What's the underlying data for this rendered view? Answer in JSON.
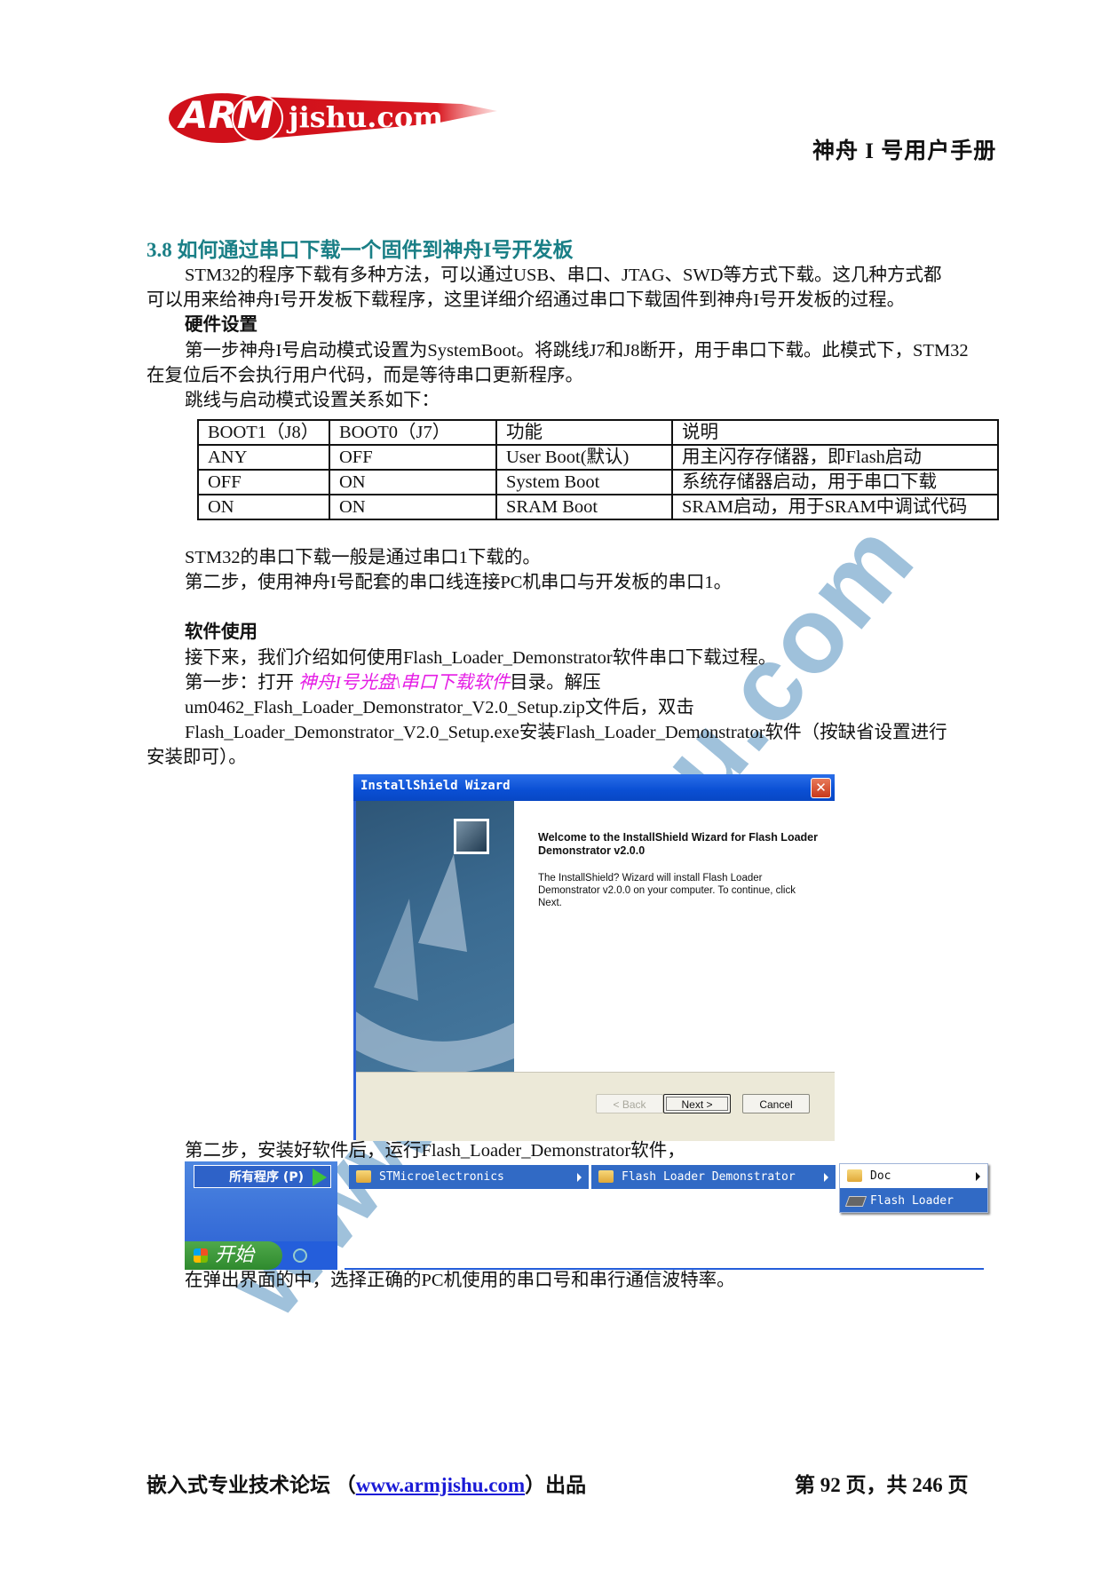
{
  "header": {
    "logo_text_arm": "ARM",
    "logo_text_site": "jishu.com",
    "doc_title": "神舟 I 号用户手册"
  },
  "section": {
    "title": "3.8 如何通过串口下载一个固件到神舟I号开发板",
    "intro_line1": "STM32的程序下载有多种方法，可以通过USB、串口、JTAG、SWD等方式下载。这几种方式都",
    "intro_line2": "可以用来给神舟I号开发板下载程序，这里详细介绍通过串口下载固件到神舟I号开发板的过程。",
    "hw_heading": "硬件设置",
    "hw_step1_line1": "第一步神舟I号启动模式设置为SystemBoot。将跳线J7和J8断开，用于串口下载。此模式下，STM32",
    "hw_step1_line2": "在复位后不会执行用户代码，而是等待串口更新程序。",
    "table_intro": "跳线与启动模式设置关系如下：",
    "table": {
      "headers": [
        "BOOT1（J8）",
        "BOOT0（J7）",
        "功能",
        "说明"
      ],
      "rows": [
        [
          "ANY",
          "OFF",
          "User Boot(默认)",
          "用主闪存存储器，即Flash启动"
        ],
        [
          "OFF",
          "ON",
          "System Boot",
          "系统存储器启动，用于串口下载"
        ],
        [
          "ON",
          "ON",
          "SRAM Boot",
          "SRAM启动，用于SRAM中调试代码"
        ]
      ]
    },
    "serial_note": "STM32的串口下载一般是通过串口1下载的。",
    "hw_step2": "第二步，使用神舟I号配套的串口线连接PC机串口与开发板的串口1。",
    "sw_heading": "软件使用",
    "sw_intro": "接下来，我们介绍如何使用Flash_Loader_Demonstrator软件串口下载过程。",
    "sw_step1_prefix": "第一步：打开 ",
    "sw_step1_link": "神舟I号光盘\\串口下载软件",
    "sw_step1_suffix": "目录。解压",
    "sw_step1_zip": "um0462_Flash_Loader_Demonstrator_V2.0_Setup.zip文件后，双击",
    "sw_step1_exe": "Flash_Loader_Demonstrator_V2.0_Setup.exe安装Flash_Loader_Demonstrator软件（按缺省设置进行",
    "sw_step1_end": "安装即可）。",
    "sw_step2": "第二步，安装好软件后，运行Flash_Loader_Demonstrator软件，",
    "sw_step3": "在弹出界面的中，选择正确的PC机使用的串口号和串行通信波特率。"
  },
  "wizard": {
    "title": "InstallShield Wizard",
    "close_glyph": "✕",
    "heading": "Welcome to the InstallShield Wizard for Flash Loader Demonstrator v2.0.0",
    "body": "The InstallShield? Wizard will install Flash Loader Demonstrator v2.0.0 on your computer.  To continue, click Next.",
    "back_label": "< Back",
    "next_label": "Next >",
    "cancel_label": "Cancel"
  },
  "startmenu": {
    "all_programs": "所有程序 (P)",
    "start_label": "开始",
    "menu1": "STMicroelectronics",
    "menu2": "Flash Loader Demonstrator",
    "submenu_doc": "Doc",
    "submenu_demo": "Flash Loader Demo"
  },
  "footer": {
    "left_prefix": "嵌入式专业技术论坛 （",
    "link": "www.armjishu.com",
    "left_suffix": "）出品",
    "page_info": "第 92 页，共 246 页"
  },
  "watermark": "www.armjishu.com",
  "colors": {
    "section_title": "#1a7f86",
    "link_magenta": "#e51ee5",
    "footer_link": "#1a1ad6",
    "watermark": "#6ca0c8",
    "xp_blue": "#316ac5"
  }
}
